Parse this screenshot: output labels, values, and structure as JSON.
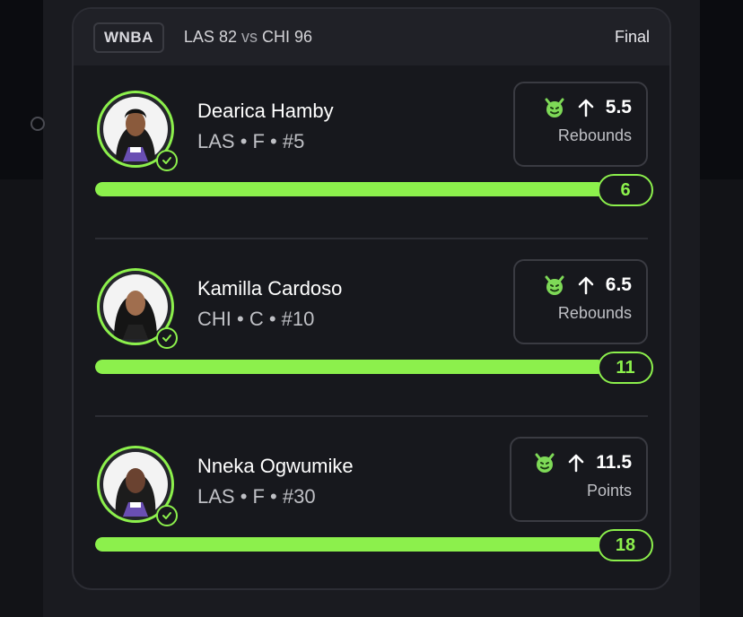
{
  "game": {
    "league": "WNBA",
    "away_team": "LAS",
    "away_score": "82",
    "vs": "vs",
    "home_team": "CHI",
    "home_score": "96",
    "status": "Final"
  },
  "colors": {
    "accent": "#8cf04c",
    "card": "#17181d",
    "header": "#202127"
  },
  "players": [
    {
      "name": "Dearica Hamby",
      "meta": "LAS • F • #5",
      "direction": "up-arrow-icon",
      "line": "5.5",
      "stat": "Rebounds",
      "result": "6",
      "progress": 1.0
    },
    {
      "name": "Kamilla Cardoso",
      "meta": "CHI • C • #10",
      "direction": "up-arrow-icon",
      "line": "6.5",
      "stat": "Rebounds",
      "result": "11",
      "progress": 1.0
    },
    {
      "name": "Nneka Ogwumike",
      "meta": "LAS • F • #30",
      "direction": "up-arrow-icon",
      "line": "11.5",
      "stat": "Points",
      "result": "18",
      "progress": 1.0
    }
  ]
}
